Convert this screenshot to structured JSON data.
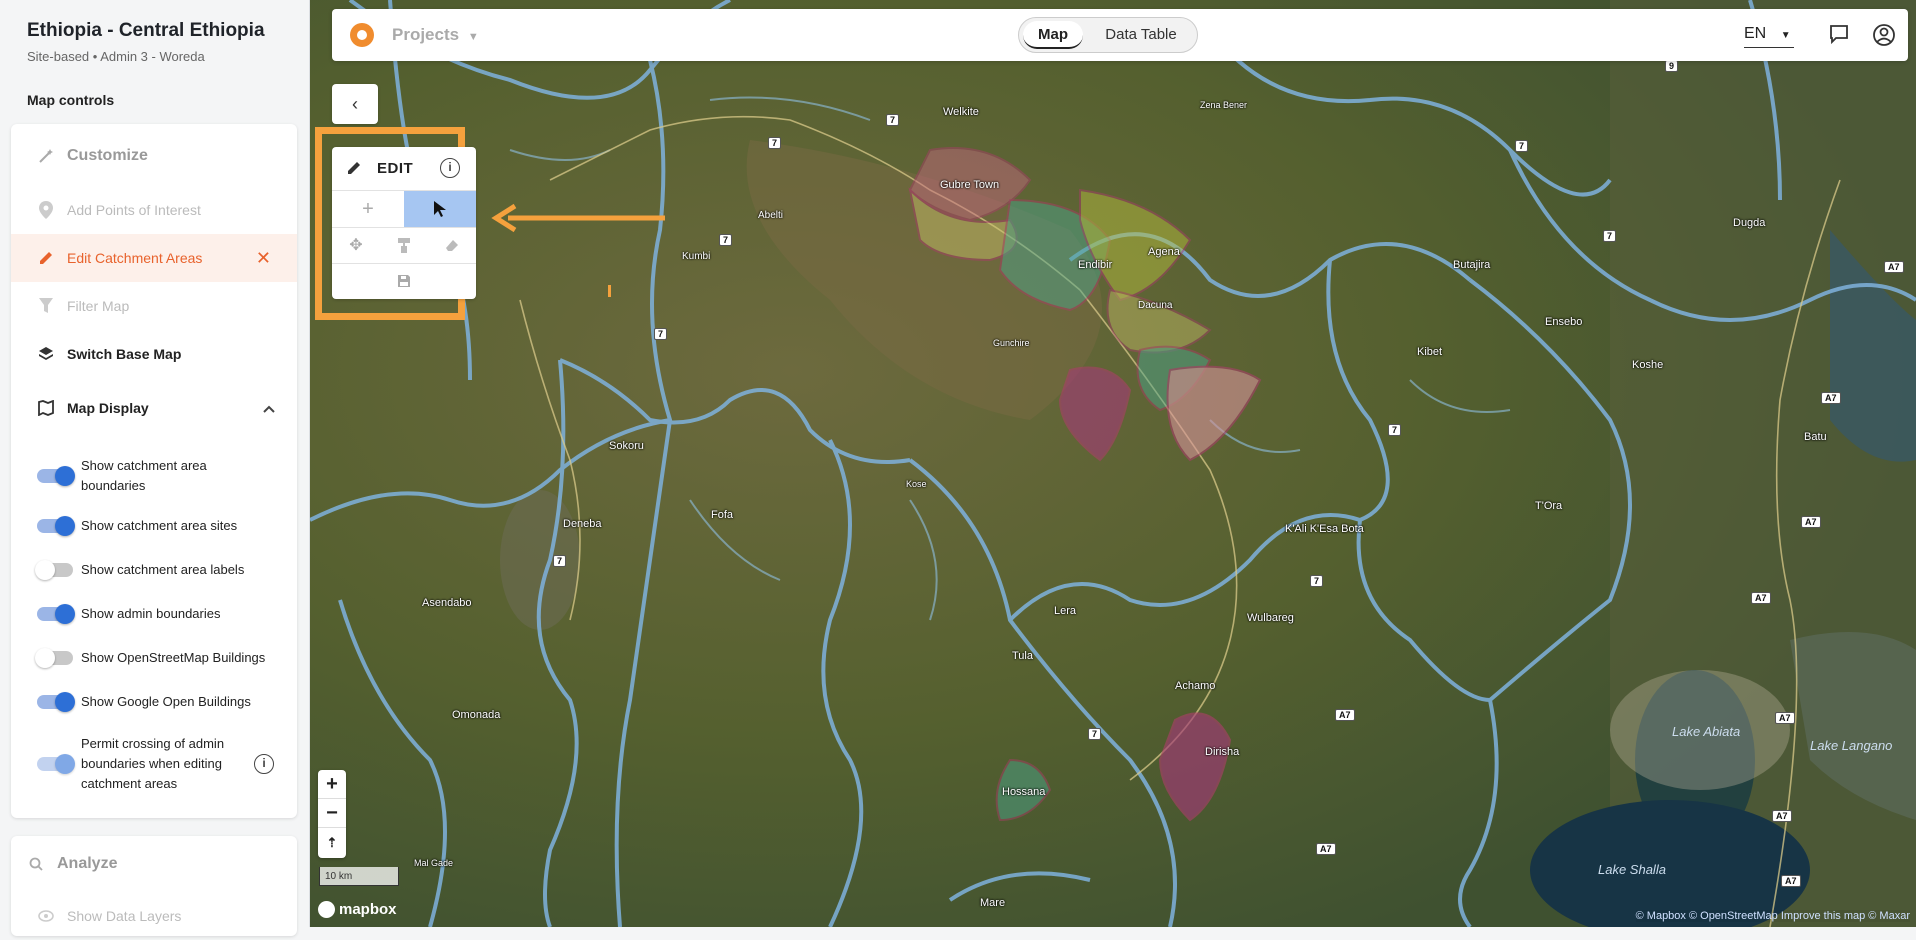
{
  "sidebar": {
    "title": "Ethiopia - Central Ethiopia",
    "subtitle": "Site-based • Admin 3 - Woreda",
    "section_label": "Map controls",
    "customize": "Customize",
    "add_poi": "Add Points of Interest",
    "edit_catchment": "Edit Catchment Areas",
    "filter_map": "Filter Map",
    "switch_base": "Switch Base Map",
    "map_display": "Map Display",
    "toggles": [
      {
        "label": "Show catchment area boundaries",
        "on": true
      },
      {
        "label": "Show catchment area sites",
        "on": true
      },
      {
        "label": "Show catchment area labels",
        "on": false
      },
      {
        "label": "Show admin boundaries",
        "on": true
      },
      {
        "label": "Show OpenStreetMap Buildings",
        "on": false
      },
      {
        "label": "Show Google Open Buildings",
        "on": true
      },
      {
        "label": "Permit crossing of admin boundaries when editing catchment areas",
        "on": true
      }
    ],
    "analyze": "Analyze",
    "show_data_layers": "Show Data Layers"
  },
  "topbar": {
    "projects": "Projects",
    "tab_map": "Map",
    "tab_table": "Data Table",
    "language": "EN"
  },
  "edit_panel": {
    "label": "EDIT"
  },
  "map": {
    "scale": "10 km",
    "mapbox": "mapbox",
    "attribution": "© Mapbox © OpenStreetMap  Improve this map  © Maxar",
    "places": [
      "Welkite",
      "Zena Bener",
      "Gubre Town",
      "Abelti",
      "Kumbi",
      "Agena",
      "Endibir",
      "Dacuna",
      "Gunchire",
      "Butajira",
      "Ensebo",
      "Kibet",
      "Koshe",
      "Dugda",
      "Sokoru",
      "Kose",
      "Fofa",
      "Deneba",
      "T'Ora",
      "K'Ali K'Esa Bota",
      "Batu",
      "Lera",
      "Wulbareg",
      "Asendabo",
      "Tula",
      "Achamo",
      "Omonada",
      "Dirisha",
      "Hossana",
      "Mal Gade",
      "Mare"
    ],
    "lakes": [
      "Lake Abiata",
      "Lake Langano",
      "Lake Shalla"
    ],
    "roads": [
      "7",
      "7",
      "7",
      "7",
      "7",
      "7",
      "7",
      "7",
      "7",
      "7",
      "A7",
      "A7",
      "A7",
      "A7",
      "A7",
      "A7",
      "A7",
      "A7",
      "A7",
      "9"
    ]
  },
  "colors": {
    "accent": "#e8622c",
    "toggle_on": "#2d6fd6",
    "highlight": "#f5a13d"
  }
}
